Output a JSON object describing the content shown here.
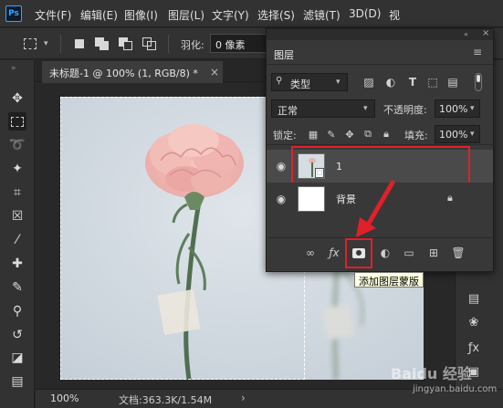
{
  "app": {
    "logo": "Ps",
    "menu": [
      "文件(F)",
      "编辑(E)",
      "图像(I)",
      "图层(L)",
      "文字(Y)",
      "选择(S)",
      "滤镜(T)",
      "3D(D)",
      "视"
    ]
  },
  "options": {
    "feather_label": "羽化:",
    "feather_value": "0 像素"
  },
  "document": {
    "tab_title": "未标题-1 @ 100% (1, RGB/8) *",
    "close": "×"
  },
  "status": {
    "zoom": "100%",
    "doc_info": "文档:363.3K/1.54M",
    "arrow": "›"
  },
  "layers_panel": {
    "title": "图层",
    "filter_kind": "类型",
    "blend_mode": "正常",
    "opacity_label": "不透明度:",
    "opacity_value": "100%",
    "lock_label": "锁定:",
    "fill_label": "填充:",
    "fill_value": "100%",
    "layers": [
      {
        "name": "1",
        "visible": true
      },
      {
        "name": "背景",
        "visible": true,
        "locked": true
      }
    ]
  },
  "tooltip": "添加图层蒙版",
  "watermark": {
    "brand": "Baidu 经验",
    "url": "jingyan.baidu.com"
  },
  "colors": {
    "highlight": "#e0202a",
    "tooltip_bg": "#ffffe1",
    "canvas_bg": "#cfd7df"
  }
}
